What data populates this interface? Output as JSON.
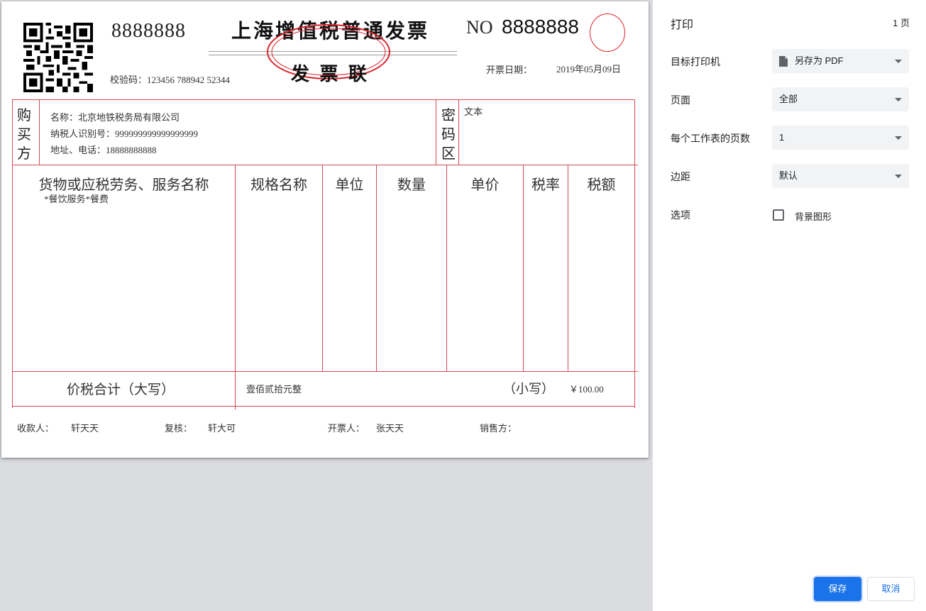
{
  "invoice": {
    "code_number": "8888888",
    "title": "上海增值税普通发票",
    "no_label": "NO",
    "no_value": "8888888",
    "subtitle": "发 票 联",
    "check_code": "校验码：123456 788942 52344",
    "date_label": "开票日期：",
    "date_value": "2019年05月09日",
    "buyer_label_1": "购",
    "buyer_label_2": "买",
    "buyer_label_3": "方",
    "buyer_name": "名称：北京地铁税务局有限公司",
    "buyer_tax_id": "纳税人识别号：999999999999999999",
    "buyer_addr": "地址、电话：18888888888",
    "cipher_label_1": "密",
    "cipher_label_2": "码",
    "cipher_label_3": "区",
    "cipher_text": "文本",
    "columns": [
      "货物或应税劳务、服务名称",
      "规格名称",
      "单位",
      "数量",
      "单价",
      "税率",
      "税额"
    ],
    "item_name": "*餐饮服务*餐费",
    "total_label": "价税合计（大写）",
    "total_uppercase": "壹佰贰拾元整",
    "small_label": "（小写）",
    "small_value": "￥100.00",
    "payee_label": "收款人：",
    "payee": "轩天天",
    "reviewer_label": "复核：",
    "reviewer": "轩大可",
    "issuer_label": "开票人：",
    "issuer": "张天天",
    "seller_label": "销售方："
  },
  "panel": {
    "title": "打印",
    "page_count": "1 页",
    "printer_label": "目标打印机",
    "printer_value": "另存为 PDF",
    "pages_label": "页面",
    "pages_value": "全部",
    "per_sheet_label": "每个工作表的页数",
    "per_sheet_value": "1",
    "margins_label": "边距",
    "margins_value": "默认",
    "options_label": "选项",
    "bg_graphics_label": "背景图形",
    "bg_graphics_checked": false,
    "save_label": "保存",
    "cancel_label": "取消",
    "accent": "#1a73e8"
  }
}
